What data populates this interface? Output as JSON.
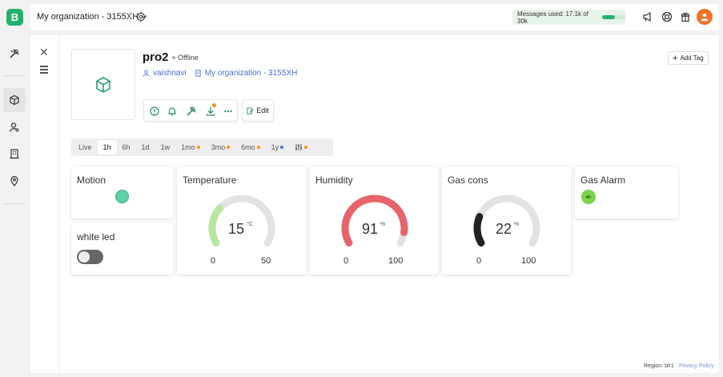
{
  "brand": {
    "logo_letter": "B",
    "color": "#23b26d"
  },
  "header": {
    "org_name": "My organization - 3155XH",
    "messages_label": "Messages used: 17.1k of 30k",
    "messages_used_fraction": 0.57
  },
  "device": {
    "name": "pro2",
    "status": "Offline",
    "owner": "vaishnavi",
    "organization": "My organization - 3155XH",
    "add_tag_label": "Add Tag",
    "edit_label": "Edit"
  },
  "time_range": {
    "options": [
      {
        "label": "Live",
        "dot": ""
      },
      {
        "label": "1h",
        "dot": "",
        "active": true
      },
      {
        "label": "6h",
        "dot": ""
      },
      {
        "label": "1d",
        "dot": ""
      },
      {
        "label": "1w",
        "dot": ""
      },
      {
        "label": "1mo",
        "dot": "#f09a12"
      },
      {
        "label": "3mo",
        "dot": "#f09a12"
      },
      {
        "label": "6mo",
        "dot": "#f09a12"
      },
      {
        "label": "1y",
        "dot": "#3b7bea"
      }
    ],
    "settings_dot": "#f09a12"
  },
  "widgets": {
    "motion": {
      "title": "Motion",
      "color": "#5ed0a6"
    },
    "white_led": {
      "title": "white led",
      "state": "off"
    },
    "temperature": {
      "title": "Temperature",
      "value": "15",
      "unit": "°C",
      "min": "0",
      "max": "50",
      "color": "#b9e6a0"
    },
    "humidity": {
      "title": "Humidity",
      "value": "91",
      "unit": "%",
      "min": "0",
      "max": "100",
      "color": "#e8636b"
    },
    "gas_cons": {
      "title": "Gas cons",
      "value": "22",
      "unit": "%",
      "min": "0",
      "max": "100",
      "color": "#222222"
    },
    "gas_alarm": {
      "title": "Gas Alarm",
      "color": "#7ad34a"
    }
  },
  "footer": {
    "region": "Region: blr1",
    "privacy": "Privacy Policy"
  }
}
